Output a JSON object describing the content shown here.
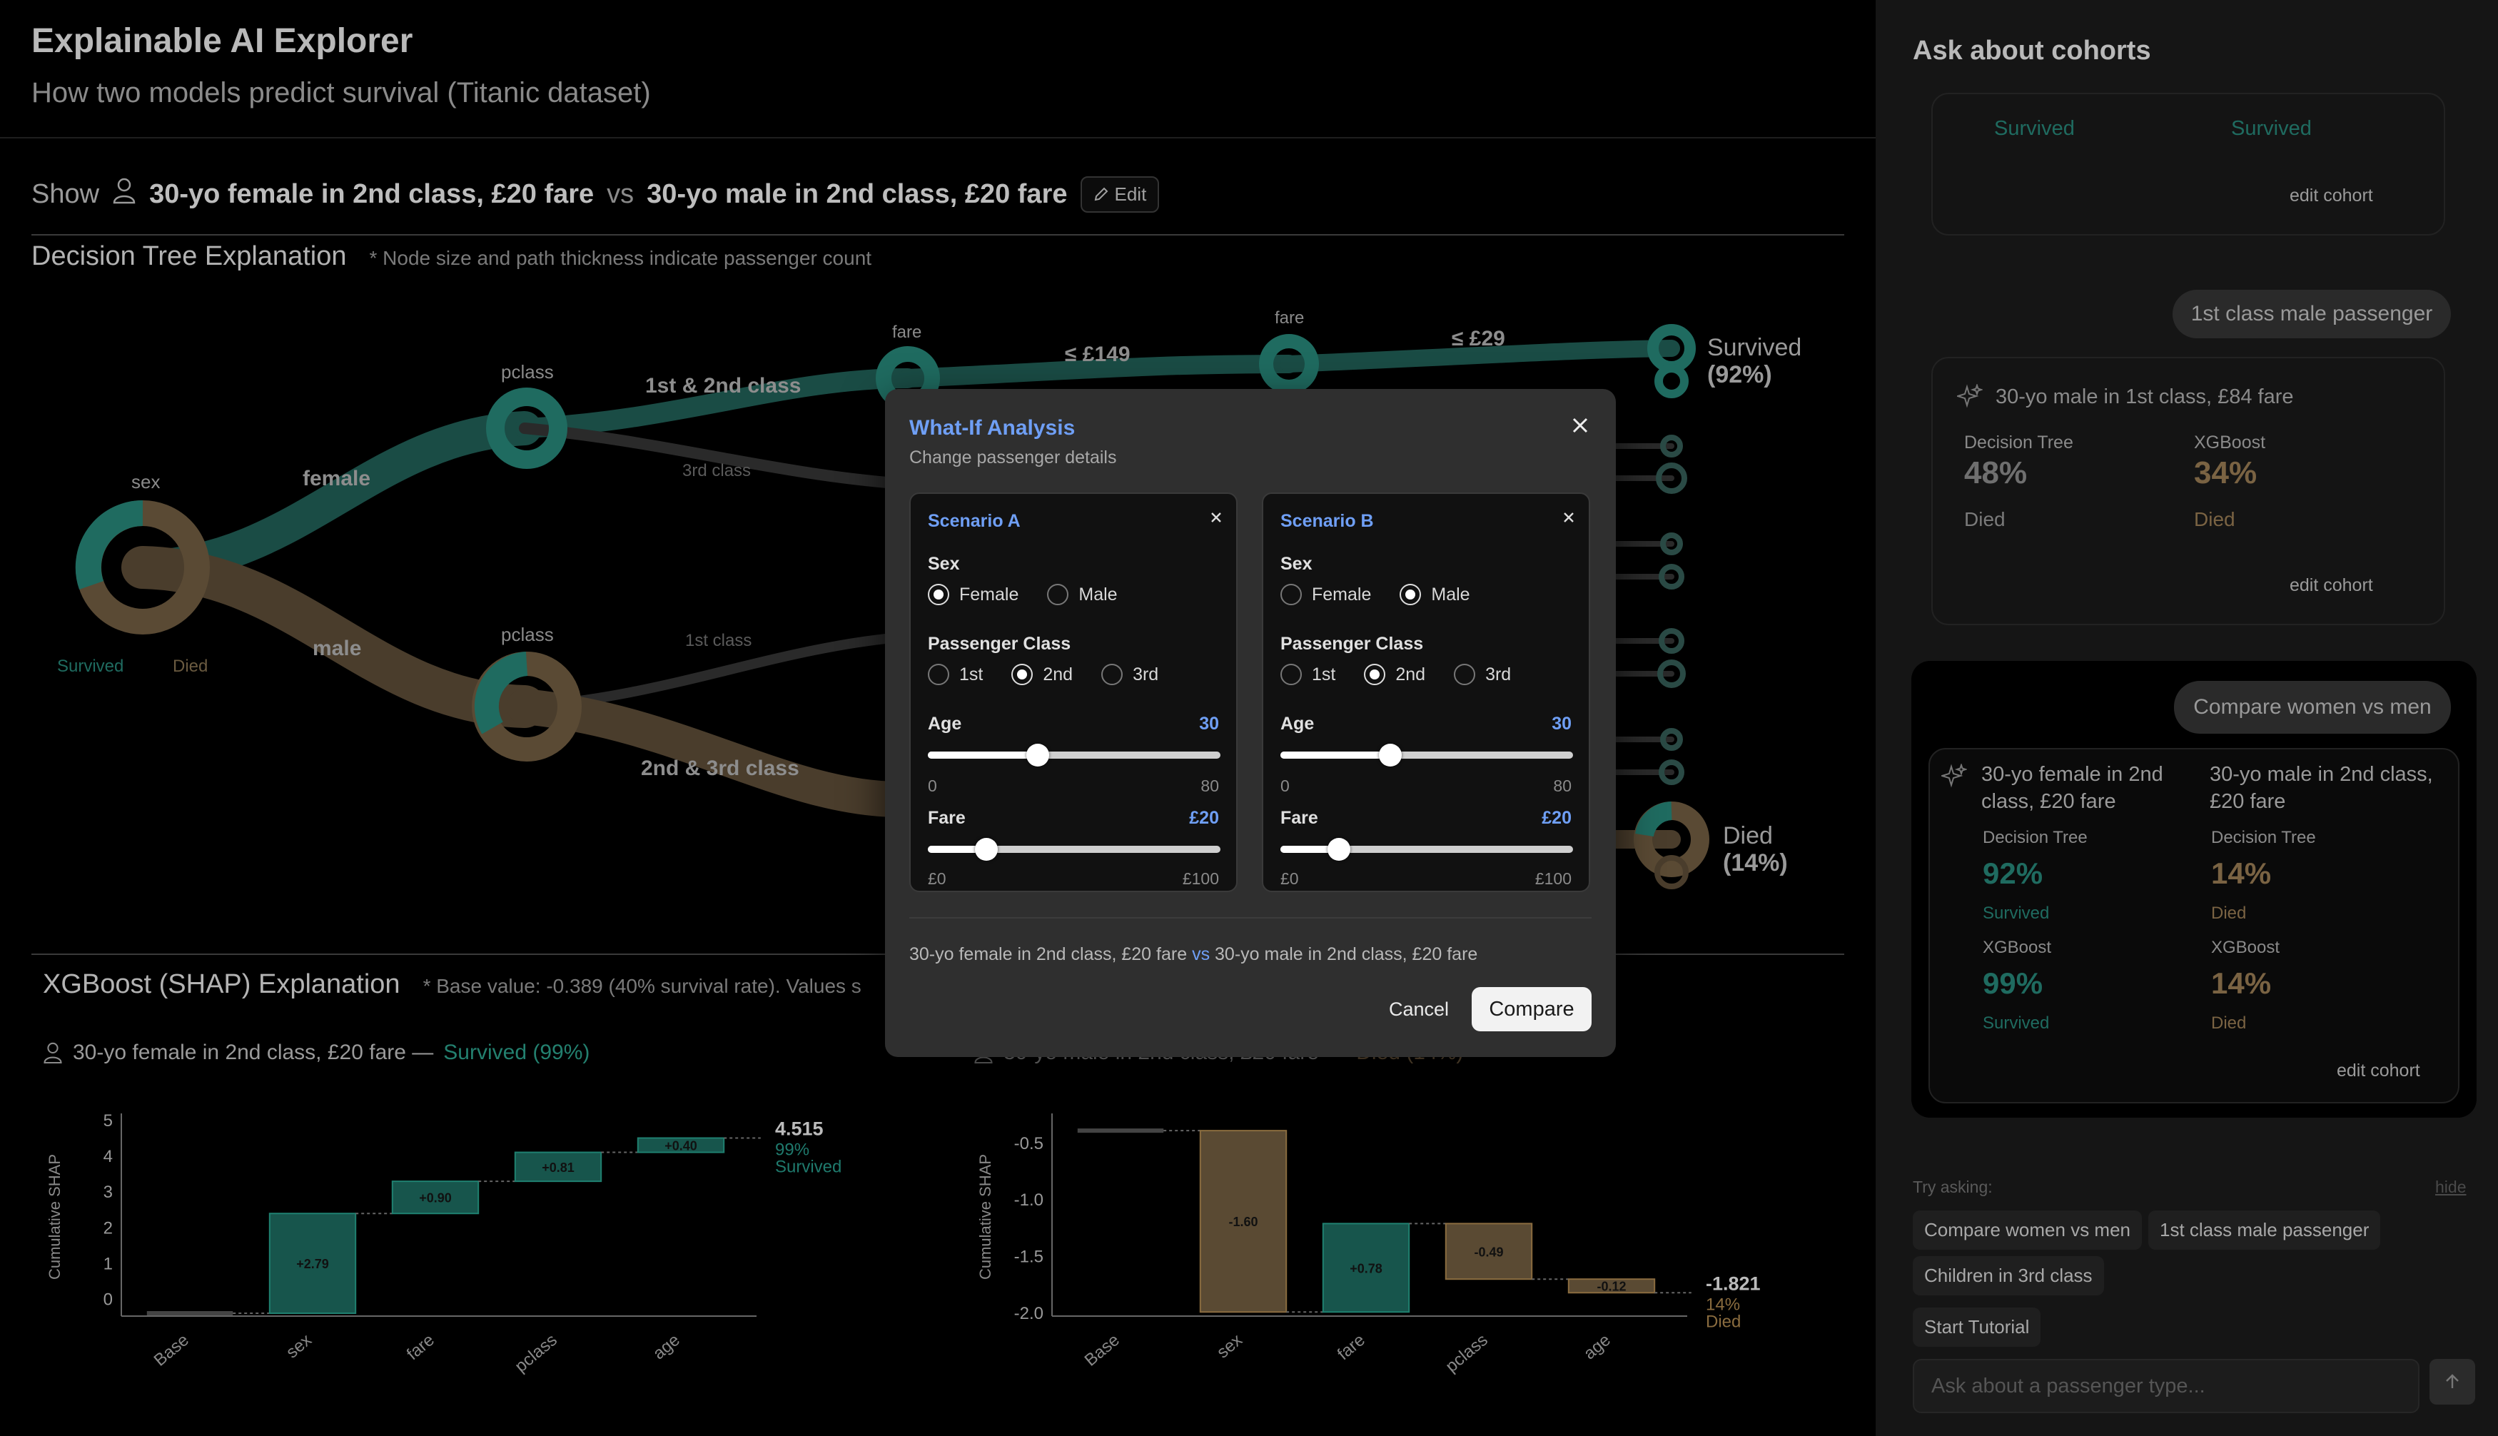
{
  "app": {
    "title": "Explainable AI Explorer",
    "subtitle": "How two models predict survival (Titanic dataset)"
  },
  "show_bar": {
    "label": "Show",
    "cohort_a": "30-yo female in 2nd class, £20 fare",
    "vs": "vs",
    "cohort_b": "30-yo male in 2nd class, £20 fare",
    "edit_label": "Edit"
  },
  "tree_section": {
    "title": "Decision Tree Explanation",
    "note": "* Node size and path thickness indicate passenger count",
    "nodes": {
      "root": "sex",
      "p1": "pclass",
      "p2": "pclass",
      "f1": "fare",
      "f2": "fare"
    },
    "edges": {
      "female": "female",
      "male": "male",
      "c12": "1st & 2nd class",
      "c3": "3rd class",
      "c1": "1st class",
      "c23": "2nd & 3rd class",
      "le149": "≤ £149",
      "le29": "≤ £29"
    },
    "legend": {
      "survived": "Survived",
      "died": "Died"
    },
    "outcomes": {
      "survived_label": "Survived",
      "survived_pct": "(92%)",
      "died_label": "Died",
      "died_pct": "(14%)"
    }
  },
  "shap_section": {
    "title": "XGBoost (SHAP) Explanation",
    "note": "* Base value: -0.389 (40% survival rate). Values s",
    "panel_a": {
      "cohort": "30-yo female in 2nd class, £20 fare —",
      "result": "Survived (99%)"
    },
    "panel_b": {
      "cohort": "30-yo male in 2nd class, £20 fare —",
      "result": "Died (14%)"
    }
  },
  "chart_data": [
    {
      "type": "bar",
      "subtype": "waterfall",
      "ylabel": "Cumulative SHAP",
      "categories": [
        "Base",
        "sex",
        "fare",
        "pclass",
        "age"
      ],
      "values": [
        -0.389,
        2.79,
        0.9,
        0.81,
        0.4
      ],
      "labels": [
        "",
        "+2.79",
        "+0.90",
        "+0.81",
        "+0.40"
      ],
      "final_value": "4.515",
      "final_pct": "99%",
      "final_outcome": "Survived",
      "yticks": [
        "0",
        "1",
        "2",
        "3",
        "4",
        "5"
      ],
      "ylim": [
        -0.389,
        5
      ]
    },
    {
      "type": "bar",
      "subtype": "waterfall",
      "ylabel": "Cumulative SHAP",
      "categories": [
        "Base",
        "sex",
        "fare",
        "pclass",
        "age"
      ],
      "values": [
        -0.389,
        -1.6,
        0.78,
        -0.49,
        -0.12
      ],
      "labels": [
        "",
        "-1.60",
        "+0.78",
        "-0.49",
        "-0.12"
      ],
      "final_value": "-1.821",
      "final_pct": "14%",
      "final_outcome": "Died",
      "yticks": [
        "-0.5",
        "-1.0",
        "-1.5",
        "-2.0"
      ],
      "ylim": [
        -2.0,
        -0.3
      ]
    }
  ],
  "sidebar": {
    "title": "Ask about cohorts",
    "card1": {
      "left_status": "Survived",
      "right_status": "Survived",
      "edit": "edit cohort"
    },
    "query2": "1st class male passenger",
    "card2": {
      "title": "30-yo male in 1st class, £84 fare",
      "model_a": "Decision Tree",
      "pct_a": "48%",
      "status_a": "Died",
      "model_b": "XGBoost",
      "pct_b": "34%",
      "status_b": "Died",
      "edit": "edit cohort"
    },
    "query3": "Compare women vs men",
    "card3": {
      "left_title": "30-yo female in 2nd class, £20 fare",
      "right_title": "30-yo male in 2nd class, £20 fare",
      "l_model1": "Decision Tree",
      "l_pct1": "92%",
      "l_status1": "Survived",
      "l_model2": "XGBoost",
      "l_pct2": "99%",
      "l_status2": "Survived",
      "r_model1": "Decision Tree",
      "r_pct1": "14%",
      "r_status1": "Died",
      "r_model2": "XGBoost",
      "r_pct2": "14%",
      "r_status2": "Died",
      "edit": "edit cohort"
    },
    "try_asking": "Try asking:",
    "hide": "hide",
    "suggestions": [
      "Compare women vs men",
      "1st class male passenger",
      "Children in 3rd class"
    ],
    "tutorial": "Start Tutorial",
    "input_placeholder": "Ask about a passenger type..."
  },
  "modal": {
    "title": "What-If Analysis",
    "subtitle": "Change passenger details",
    "scenario_a": {
      "title": "Scenario A",
      "sex_label": "Sex",
      "sex_options": [
        "Female",
        "Male"
      ],
      "sex_selected": "Female",
      "class_label": "Passenger Class",
      "class_options": [
        "1st",
        "2nd",
        "3rd"
      ],
      "class_selected": "2nd",
      "age_label": "Age",
      "age_value": "30",
      "age_min": "0",
      "age_max": "80",
      "age_num": 30,
      "age_range": [
        0,
        80
      ],
      "fare_label": "Fare",
      "fare_value": "£20",
      "fare_min": "£0",
      "fare_max": "£100",
      "fare_num": 20,
      "fare_range": [
        0,
        100
      ]
    },
    "scenario_b": {
      "title": "Scenario B",
      "sex_label": "Sex",
      "sex_options": [
        "Female",
        "Male"
      ],
      "sex_selected": "Male",
      "class_label": "Passenger Class",
      "class_options": [
        "1st",
        "2nd",
        "3rd"
      ],
      "class_selected": "2nd",
      "age_label": "Age",
      "age_value": "30",
      "age_min": "0",
      "age_max": "80",
      "age_num": 30,
      "age_range": [
        0,
        80
      ],
      "fare_label": "Fare",
      "fare_value": "£20",
      "fare_min": "£0",
      "fare_max": "£100",
      "fare_num": 20,
      "fare_range": [
        0,
        100
      ]
    },
    "summary_a": "30-yo female in 2nd class, £20 fare",
    "summary_vs": "vs",
    "summary_b": "30-yo male in 2nd class, £20 fare",
    "cancel": "Cancel",
    "compare": "Compare"
  },
  "colors": {
    "survived": "#1f6b60",
    "died": "#7a6343",
    "accent": "#6f9ff5"
  }
}
